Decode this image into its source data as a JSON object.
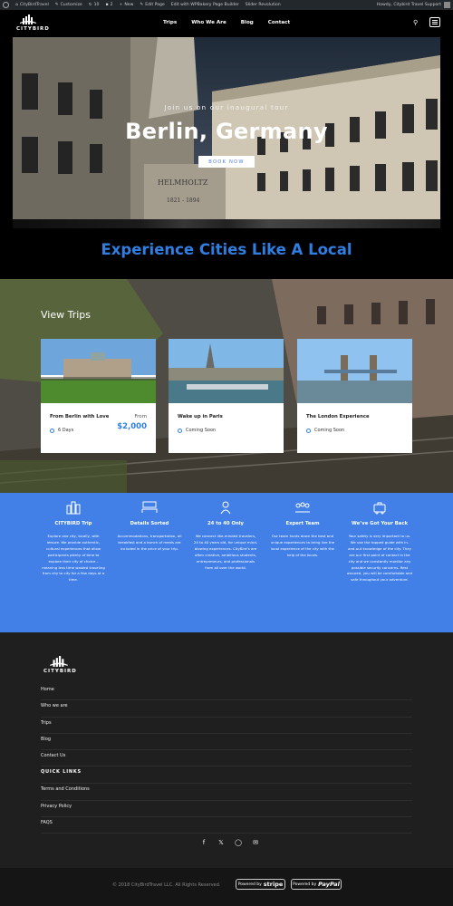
{
  "admin_bar": {
    "site": "CityBirdTravel",
    "customize": "Customize",
    "updates": "10",
    "comments": "2",
    "new": "New",
    "edit_page": "Edit Page",
    "wpbakery": "Edit with WPBakery Page Builder",
    "slider": "Slider Revolution",
    "howdy": "Howdy, Citybird Travel Support"
  },
  "header": {
    "logo_text": "CITYBIRD",
    "nav": [
      "Trips",
      "Who We Are",
      "Blog",
      "Contact"
    ]
  },
  "hero": {
    "subtitle": "Join us on our inaugural tour",
    "title": "Berlin, Germany",
    "button": "BOOK NOW",
    "carving": "HELMHOLTZ",
    "carving_years": "1821 - 1894"
  },
  "tagline": "Experience Cities Like A Local",
  "trips": {
    "title": "View Trips",
    "cards": [
      {
        "title": "From Berlin with Love",
        "meta": "6 Days",
        "price_from": "From",
        "price": "$2,000"
      },
      {
        "title": "Wake up in Paris",
        "meta": "Coming Soon"
      },
      {
        "title": "The London Experience",
        "meta": "Coming Soon"
      }
    ]
  },
  "features": [
    {
      "icon": "city-icon",
      "title": "CITYBIRD Trip",
      "text": "Explore one city, locally, with leisure. We provide authentic, cultural experiences that allow participants plenty of time to explore their city of choice – meaning less time wasted traveling from city to city for a few days at a time."
    },
    {
      "icon": "bed-icon",
      "title": "Details Sorted",
      "text": "Accommodations, transportation, all breakfast and a bunch of meals are included in the price of your trip."
    },
    {
      "icon": "person-icon",
      "title": "24 to 40 Only",
      "text": "We connect like-minded travelers, 24 to 40 years old, for unique mind-blowing experiences. CityBird’s are often creative, ambitious students, entrepreneurs, and professionals from all over the world."
    },
    {
      "icon": "team-icon",
      "title": "Expert Team",
      "text": "Our team hunts down the best and unique experiences to bring live the local experience of the city with the help of the locals."
    },
    {
      "icon": "luggage-icon",
      "title": "We’ve Got Your Back",
      "text": "Your safety is very important to us. We use the topped guide with in-and-out knowledge of the city. They are our first point of contact in the city and we constantly monitor any possible security concerns. Rest assured, you will be comfortable and safe throughout your adventure."
    }
  ],
  "footer": {
    "logo_text": "CITYBIRD",
    "links": [
      "Home",
      "Who we are",
      "Trips",
      "Blog",
      "Contact Us"
    ],
    "quick_links_heading": "QUICK LINKS",
    "quick_links": [
      "Terms and Conditions",
      "Privacy Policy",
      "FAQS"
    ],
    "socials": [
      "facebook-icon",
      "twitter-icon",
      "instagram-icon",
      "email-icon"
    ],
    "copyright": "© 2018 CityBirdTravel LLC. All Rights Reserved.",
    "stripe_prefix": "Powered by",
    "stripe": "stripe",
    "paypal_prefix": "Powered by",
    "paypal": "PayPal"
  },
  "colors": {
    "accent": "#2f7fe3",
    "features_bg": "#4280e8",
    "footer_bg": "#1f1f1f"
  }
}
